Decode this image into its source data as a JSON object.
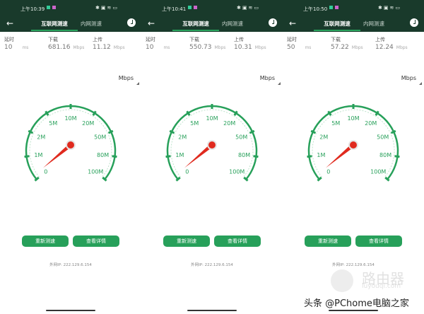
{
  "panels": [
    {
      "time": "上午10:39",
      "latency": "10",
      "download": "681.16",
      "upload": "11.12"
    },
    {
      "time": "上午10:41",
      "latency": "10",
      "download": "550.73",
      "upload": "10.31"
    },
    {
      "time": "上午10:50",
      "latency": "50",
      "download": "57.22",
      "upload": "12.24"
    }
  ],
  "tabs": {
    "internet": "互联网测速",
    "lan": "内网测速"
  },
  "labels": {
    "latency": "延时",
    "download": "下载",
    "upload": "上传",
    "ms": "ms",
    "mbps": "Mbps"
  },
  "unit_selector": "Mbps",
  "gauge_ticks": [
    "0",
    "1M",
    "2M",
    "5M",
    "10M",
    "20M",
    "50M",
    "80M",
    "100M"
  ],
  "buttons": {
    "retest": "重新测速",
    "details": "查看详情"
  },
  "ip": "外网IP: 222.129.6.154",
  "watermark": {
    "brand": "路由器",
    "domain": "luyouqi.com",
    "credit": "头条 @PChome电脑之家"
  },
  "colors": {
    "header": "#193a2b",
    "accent": "#27a05a",
    "needle": "#e02a1e"
  }
}
